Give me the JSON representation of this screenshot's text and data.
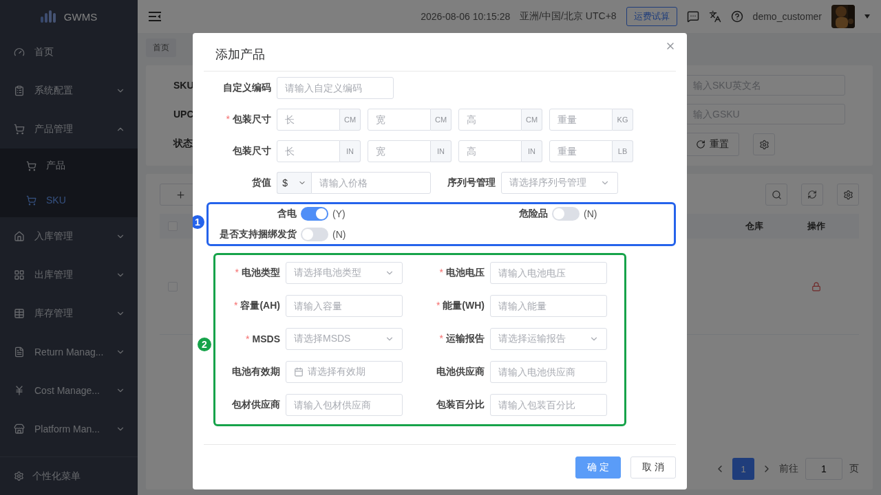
{
  "sidebar": {
    "logo": "GWMS",
    "items": [
      {
        "label": "首页",
        "expandable": false
      },
      {
        "label": "系统配置",
        "expandable": true,
        "expanded": false
      },
      {
        "label": "产品管理",
        "expandable": true,
        "expanded": true,
        "children": [
          {
            "label": "产品",
            "selected": false
          },
          {
            "label": "SKU",
            "selected": true
          }
        ]
      },
      {
        "label": "入库管理",
        "expandable": true,
        "expanded": false
      },
      {
        "label": "出库管理",
        "expandable": true,
        "expanded": false
      },
      {
        "label": "库存管理",
        "expandable": true,
        "expanded": false
      },
      {
        "label": "Return Manag...",
        "expandable": true,
        "expanded": false
      },
      {
        "label": "Cost Manage...",
        "expandable": true,
        "expanded": false
      },
      {
        "label": "Platform Man...",
        "expandable": true,
        "expanded": false
      }
    ],
    "footer": "个性化菜单"
  },
  "header": {
    "datetime": "2026-08-06 10:15:28",
    "timezone": "亚洲/中国/北京 UTC+8",
    "calc_button": "运费试算",
    "user": "demo_customer"
  },
  "page": {
    "tabs": [
      "首页"
    ],
    "filter_labels": [
      "SKU",
      "UPC",
      "状态"
    ],
    "filter_placeholders": [
      "输入SKU英文名",
      "输入GSKU"
    ],
    "reset_button": "重置",
    "table": {
      "columns": [
        "仓库",
        "操作"
      ],
      "header_checked": false,
      "rows": [
        {
          "checked": false
        }
      ]
    },
    "pagination": {
      "current": "1",
      "goto_label": "前往",
      "goto_value": "1",
      "page_label": "页"
    }
  },
  "modal": {
    "title": "添加产品",
    "required_mark": "*",
    "code_row": {
      "label": "自定义编码",
      "placeholder": "请输入自定义编码"
    },
    "size_rows": [
      {
        "label": "包装尺寸",
        "required": true,
        "fields": [
          {
            "placeholder": "长",
            "unit": "CM"
          },
          {
            "placeholder": "宽",
            "unit": "CM"
          },
          {
            "placeholder": "高",
            "unit": "CM"
          },
          {
            "placeholder": "重量",
            "unit": "KG"
          }
        ]
      },
      {
        "label": "包装尺寸",
        "required": false,
        "fields": [
          {
            "placeholder": "长",
            "unit": "IN"
          },
          {
            "placeholder": "宽",
            "unit": "IN"
          },
          {
            "placeholder": "高",
            "unit": "IN"
          },
          {
            "placeholder": "重量",
            "unit": "LB"
          }
        ]
      }
    ],
    "value_row": {
      "label": "货值",
      "currency": "$",
      "placeholder": "请输入价格",
      "serial_label": "序列号管理",
      "serial_placeholder": "请选择序列号管理"
    },
    "switch_group": {
      "badge": "1",
      "color": "#2563eb",
      "switches": [
        {
          "label": "含电",
          "on": true,
          "state_text": "(Y)"
        },
        {
          "label": "危险品",
          "on": false,
          "state_text": "(N)"
        },
        {
          "label": "是否支持捆绑发货",
          "on": false,
          "state_text": "(N)"
        }
      ]
    },
    "battery_group": {
      "badge": "2",
      "color": "#16a34a",
      "fields": [
        {
          "label": "电池类型",
          "required": true,
          "kind": "select",
          "placeholder": "请选择电池类型"
        },
        {
          "label": "电池电压",
          "required": true,
          "kind": "input",
          "placeholder": "请输入电池电压"
        },
        {
          "label": "容量(AH)",
          "required": true,
          "kind": "input",
          "placeholder": "请输入容量"
        },
        {
          "label": "能量(WH)",
          "required": true,
          "kind": "input",
          "placeholder": "请输入能量"
        },
        {
          "label": "MSDS",
          "required": true,
          "kind": "select",
          "placeholder": "请选择MSDS"
        },
        {
          "label": "运输报告",
          "required": true,
          "kind": "select",
          "placeholder": "请选择运输报告"
        },
        {
          "label": "电池有效期",
          "required": false,
          "kind": "date",
          "placeholder": "请选择有效期"
        },
        {
          "label": "电池供应商",
          "required": false,
          "kind": "input",
          "placeholder": "请输入电池供应商"
        },
        {
          "label": "包材供应商",
          "required": false,
          "kind": "input",
          "placeholder": "请输入包材供应商"
        },
        {
          "label": "包装百分比",
          "required": false,
          "kind": "input",
          "placeholder": "请输入包装百分比"
        }
      ]
    },
    "buttons": [
      {
        "label": "确 定",
        "kind": "primary"
      },
      {
        "label": "取 消",
        "kind": "default"
      }
    ]
  }
}
